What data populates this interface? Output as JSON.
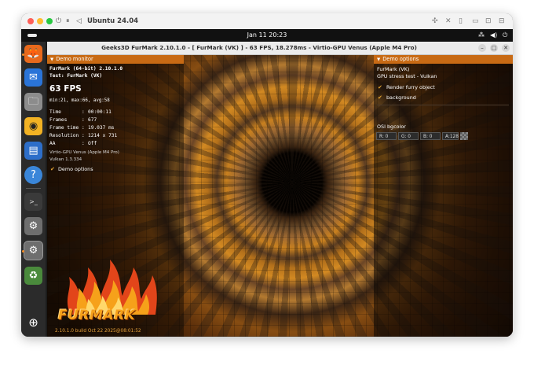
{
  "host": {
    "title": "Ubuntu 24.04",
    "controls": [
      "⏻",
      "⏸",
      "◁"
    ],
    "icons": [
      "camera-icon",
      "mute-icon",
      "usb-icon",
      "folder-icon",
      "window-icon",
      "share-icon"
    ]
  },
  "topbar": {
    "clock": "Jan 11  20:23",
    "tray": [
      "network-icon",
      "volume-icon",
      "power-icon"
    ]
  },
  "dock": {
    "apps": [
      {
        "name": "firefox",
        "icon": "🦊"
      },
      {
        "name": "thunderbird",
        "icon": "✉"
      },
      {
        "name": "files",
        "icon": "🗀"
      },
      {
        "name": "rhythmbox",
        "icon": "◉"
      },
      {
        "name": "writer",
        "icon": "▤"
      },
      {
        "name": "help",
        "icon": "?"
      },
      {
        "name": "terminal",
        "icon": ">_"
      },
      {
        "name": "settings",
        "icon": "⚙"
      },
      {
        "name": "settings-2",
        "icon": "⚙"
      },
      {
        "name": "trash",
        "icon": "♻"
      },
      {
        "name": "show-apps",
        "icon": "⊕"
      }
    ]
  },
  "app": {
    "title": "Geeks3D FurMark 2.10.1.0 - [ FurMark (VK) ] - 63 FPS, 18.278ms - Virtio-GPU Venus (Apple M4 Pro)"
  },
  "monitor": {
    "header": "Demo monitor",
    "line1": "FurMark (64-bit) 2.10.1.0",
    "line2": "Test: FurMark (VK)",
    "fps": "63 FPS",
    "minmax": "min:21, max:66, avg:58",
    "stats": [
      {
        "label": "Time",
        "value": "00:00:11"
      },
      {
        "label": "Frames",
        "value": "677"
      },
      {
        "label": "Frame time",
        "value": "19.037 ms"
      },
      {
        "label": "Resolution",
        "value": "1214 x 731"
      },
      {
        "label": "AA",
        "value": "Off"
      }
    ],
    "gpu": "Virtio-GPU Venus (Apple M4 Pro)",
    "vulkan": "Vulkan 1.3.334",
    "demo_options_label": "Demo options"
  },
  "options": {
    "header": "Demo options",
    "product": "FurMark (VK)",
    "subtitle": "GPU stress test - Vulkan",
    "render_furry": "Render furry object",
    "background": "background",
    "osi_label": "OSI bgcolor",
    "colors": {
      "r": "R: 0",
      "g": "G: 0",
      "b": "B: 0",
      "a": "A:128"
    }
  },
  "logo": {
    "text": "FURMARK",
    "build": "2.10.1.0 build Oct 22 2025@08:01:52"
  },
  "colors": {
    "accent": "#c86a14",
    "flame": "#f08a24"
  }
}
